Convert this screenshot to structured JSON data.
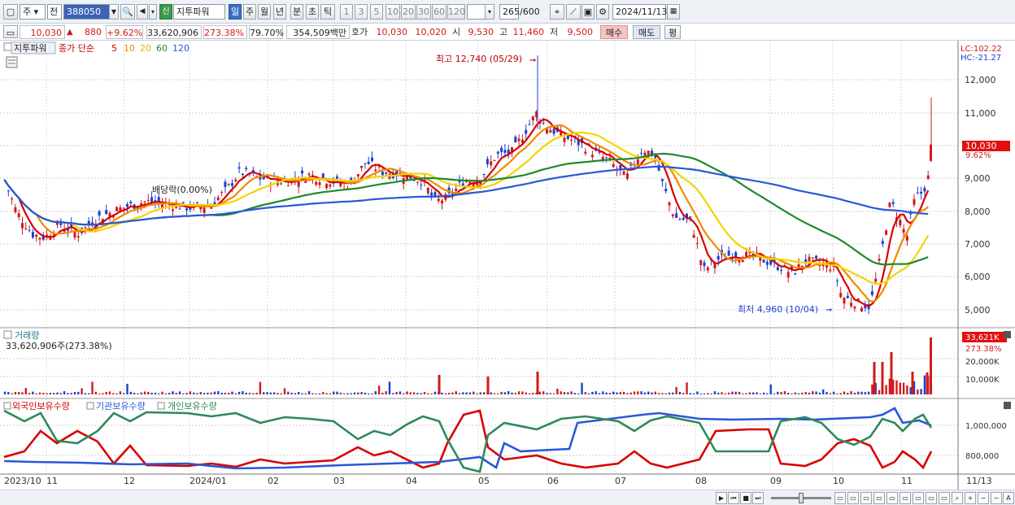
{
  "toolbar": {
    "market": "주",
    "prev": "전",
    "code": "388050",
    "shin_tag": "신",
    "stock_name": "지투파워",
    "periods": [
      "일",
      "주",
      "월",
      "년",
      "분",
      "초",
      "틱"
    ],
    "intervals": [
      "1",
      "3",
      "5",
      "10",
      "20",
      "30",
      "60",
      "120"
    ],
    "count": "265",
    "count_total": "/600",
    "date": "2024/11/13"
  },
  "quote": {
    "price": "10,030",
    "change": "880",
    "change_pct": "+9.62%",
    "volume": "33,620,906",
    "vol_ratio": "273.38%",
    "turnover": "79.70%",
    "amount": "354,509백만",
    "ask_label": "호가",
    "ask": "10,030",
    "bid": "10,020",
    "open_label": "시",
    "open": "9,530",
    "high_label": "고",
    "high": "11,460",
    "low_label": "저",
    "low": "9,500",
    "buy_label": "매수",
    "sell_label": "매도",
    "eval_label": "평"
  },
  "price_panel": {
    "name": "지투파워",
    "ma_label": "종가 단순",
    "ma_periods": [
      "5",
      "10",
      "20",
      "60",
      "120"
    ],
    "ma_colors": [
      "#d90000",
      "#f08a00",
      "#f2d500",
      "#1e8a2e",
      "#2a58d6"
    ],
    "lc": "LC:102.22",
    "hc": "HC:-21.27",
    "max_note": "최고 12,740 (05/29)",
    "min_note": "최저 4,960 (10/04)",
    "dividend_note": "배당락(0.00%)",
    "current_tag": "10,030",
    "current_pct": "9.62%",
    "y_ticks": [
      "12,000",
      "11,000",
      "10,000",
      "9,000",
      "8,000",
      "7,000",
      "6,000",
      "5,000"
    ]
  },
  "volume_panel": {
    "title": "거래량",
    "value": "33,620,906주(273.38%)",
    "tag": "33,621K",
    "tag_pct": "273.38%",
    "y_ticks": [
      "20,000K",
      "10,000K"
    ]
  },
  "holding_panel": {
    "series": [
      "외국인보유수량",
      "기관보유수량",
      "개인보유수량"
    ],
    "colors": [
      "#d90000",
      "#2a58d6",
      "#2e8a5a"
    ],
    "y_ticks": [
      "1,000,000",
      "800,000"
    ]
  },
  "x_axis": [
    "2023/10",
    "11",
    "12",
    "2024/01",
    "02",
    "03",
    "04",
    "05",
    "06",
    "07",
    "08",
    "09",
    "10",
    "11",
    "11/13"
  ],
  "colors": {
    "up": "#d21a1a",
    "down": "#1a3fd2",
    "accent": "#3c63b8"
  }
}
